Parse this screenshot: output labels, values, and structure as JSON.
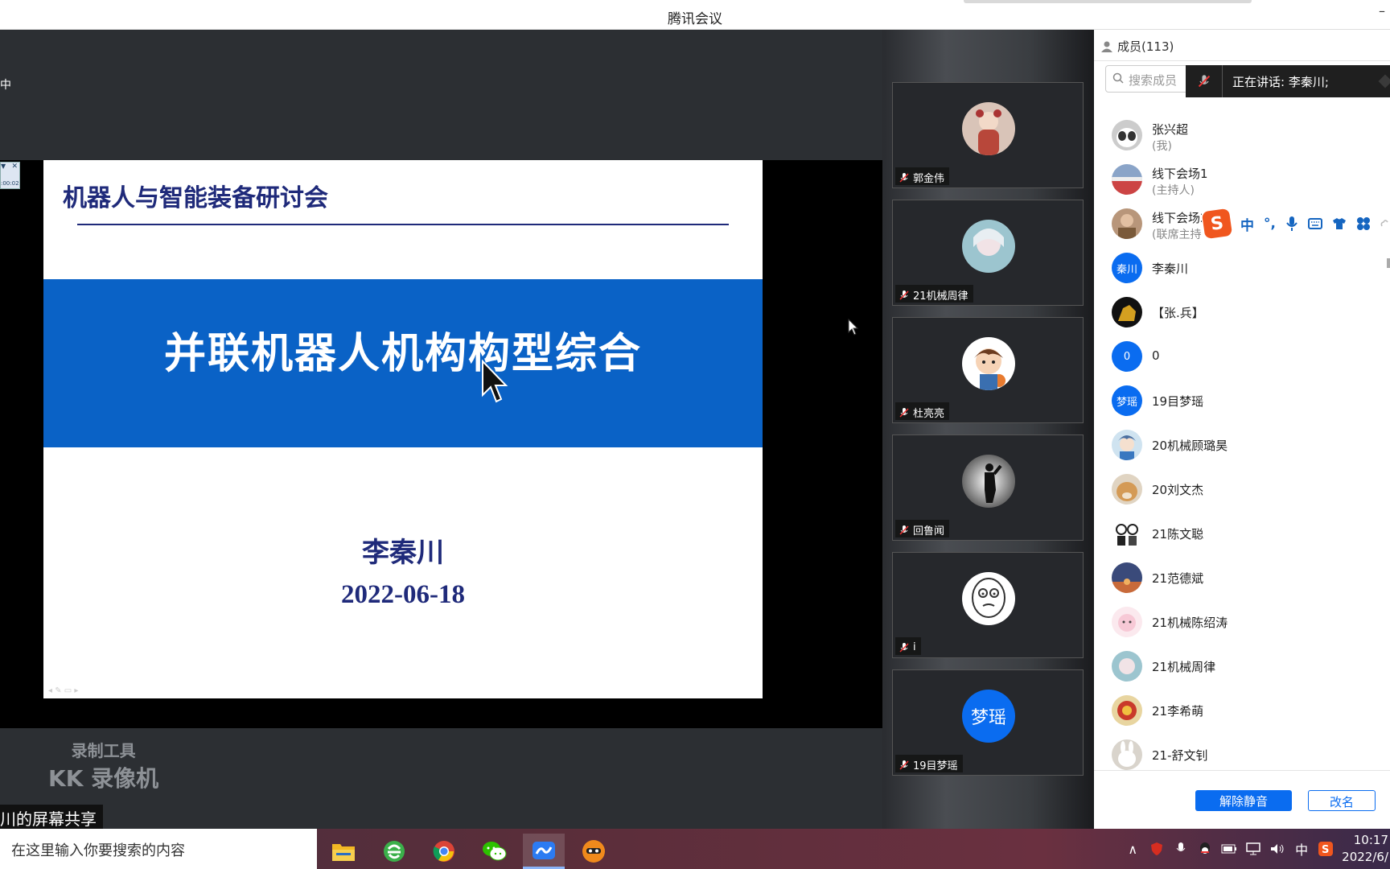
{
  "window": {
    "title": "腾讯会议",
    "minimize_glyph": "–"
  },
  "stage": {
    "top_fragment": "中",
    "mini_control": {
      "close": "✕",
      "time": ":00:02"
    },
    "slide": {
      "header": "机器人与智能装备研讨会",
      "main_title": "并联机器人机构构型综合",
      "presenter": "李秦川",
      "date": "2022-06-18"
    },
    "watermark": {
      "line1": "录制工具",
      "line2": "KK 录像机"
    },
    "share_label": "川的屏幕共享"
  },
  "video_tiles": [
    {
      "name": "郭金伟",
      "avatar": "photo-toddler"
    },
    {
      "name": "21机械周律",
      "avatar": "photo-portrait"
    },
    {
      "name": "杜亮亮",
      "avatar": "cartoon-boy"
    },
    {
      "name": "回鲁闻",
      "avatar": "silhouette"
    },
    {
      "name": "i",
      "avatar": "meme-face"
    },
    {
      "name": "19目梦瑶",
      "avatar_text": "梦瑶"
    }
  ],
  "panel": {
    "header": "成员(113)",
    "search_placeholder": "搜索成员",
    "speaking": "正在讲话: 李秦川;",
    "members": [
      {
        "name": "张兴超",
        "role": "(我)",
        "avatar": "photo-cat"
      },
      {
        "name": "线下会场1",
        "role": "(主持人)",
        "avatar": "photo-landscape"
      },
      {
        "name": "线下会场2",
        "role": "(联席主持人)",
        "avatar": "photo-person"
      },
      {
        "name": "李秦川",
        "avatar_text": "秦川"
      },
      {
        "name": "【张.兵】",
        "avatar": "photo-gold"
      },
      {
        "name": "0",
        "avatar_text": "0"
      },
      {
        "name": "19目梦瑶",
        "avatar_text": "梦瑶"
      },
      {
        "name": "20机械顾璐昊",
        "avatar": "photo-anime"
      },
      {
        "name": "20刘文杰",
        "avatar": "photo-dog"
      },
      {
        "name": "21陈文聪",
        "avatar": "sketch-people"
      },
      {
        "name": "21范德斌",
        "avatar": "photo-sunset"
      },
      {
        "name": "21机械陈绍涛",
        "avatar": "cartoon-pink"
      },
      {
        "name": "21机械周律",
        "avatar": "photo-portrait"
      },
      {
        "name": "21李希萌",
        "avatar": "photo-dragon"
      },
      {
        "name": "21-舒文钊",
        "avatar": "photo-rabbit"
      }
    ],
    "unmute_button": "解除静音",
    "rename_button": "改名"
  },
  "ime_toolbar": {
    "logo": "S",
    "mode": "中",
    "punct": "°,"
  },
  "taskbar": {
    "search_placeholder": "在这里输入你要搜索的内容",
    "apps": [
      "file-explorer",
      "ie-browser",
      "chrome",
      "wechat",
      "tencent-meeting",
      "recorder"
    ],
    "tray_lang": "中",
    "time": "10:17",
    "date": "2022/6/"
  },
  "colors": {
    "accent": "#0a6cf0",
    "slide_band": "#0a62c6",
    "slide_text": "#1f2a7a"
  }
}
